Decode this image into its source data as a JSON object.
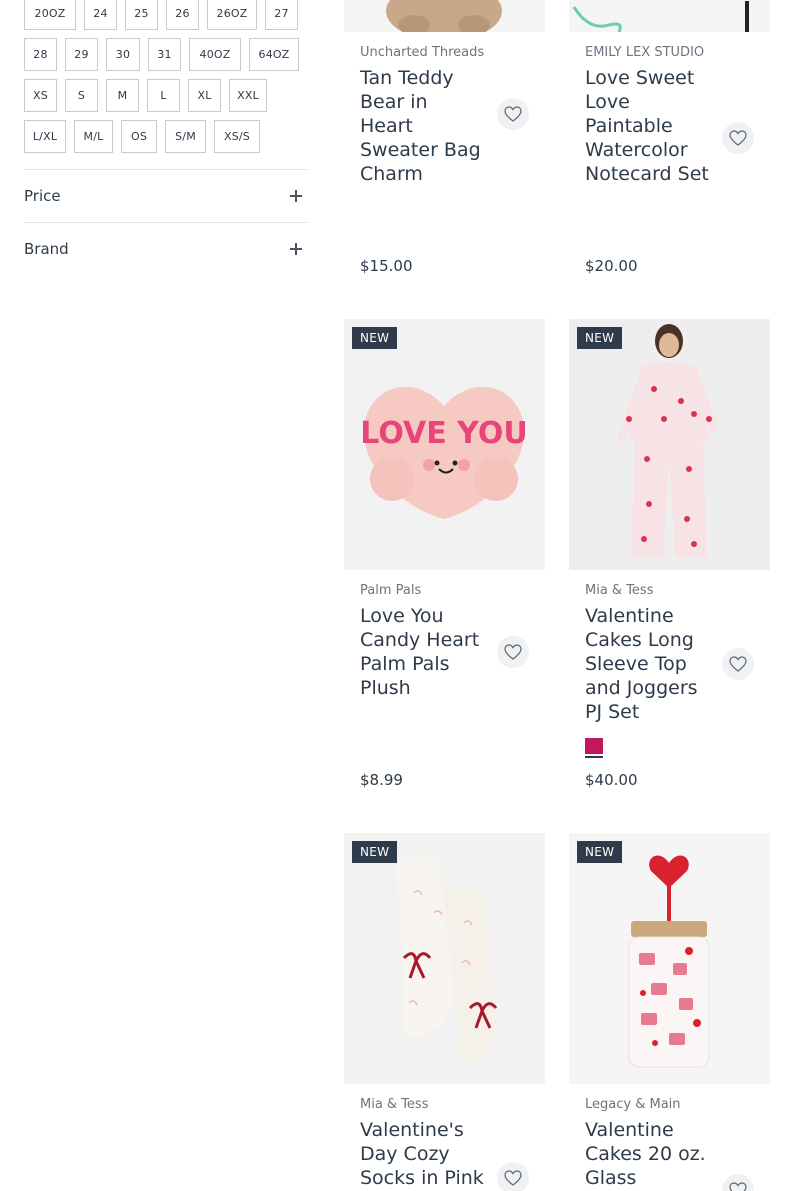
{
  "filters": {
    "sizes": [
      [
        "20OZ",
        "24",
        "25",
        "26",
        "26OZ",
        "27"
      ],
      [
        "28",
        "29",
        "30",
        "31",
        "40OZ",
        "64OZ"
      ],
      [
        "XS",
        "S",
        "M",
        "L",
        "XL",
        "XXL"
      ],
      [
        "L/XL",
        "M/L",
        "OS",
        "S/M",
        "XS/S"
      ]
    ],
    "price_label": "Price",
    "brand_label": "Brand"
  },
  "products": [
    {
      "brand": "Uncharted Threads",
      "title": "Tan Teddy Bear in Heart Sweater Bag Charm",
      "price": "$15.00"
    },
    {
      "brand": "EMILY LEX STUDIO",
      "title": "Love Sweet Love Paintable Watercolor Notecard Set",
      "price": "$20.00"
    },
    {
      "badge": "NEW",
      "brand": "Palm Pals",
      "title": "Love You Candy Heart Palm Pals Plush",
      "price": "$8.99",
      "image_text": "LOVE YOU"
    },
    {
      "badge": "NEW",
      "brand": "Mia & Tess",
      "title": "Valentine Cakes Long Sleeve Top and Joggers PJ Set",
      "price": "$40.00",
      "swatch_color": "#c2185b"
    },
    {
      "badge": "NEW",
      "brand": "Mia & Tess",
      "title": "Valentine's Day Cozy Socks in Pink"
    },
    {
      "badge": "NEW",
      "brand": "Legacy & Main",
      "title": "Valentine Cakes 20 oz. Glass"
    }
  ]
}
